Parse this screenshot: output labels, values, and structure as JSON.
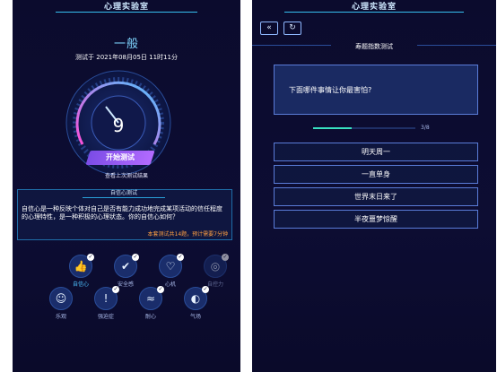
{
  "left": {
    "header_title": "心理实验室",
    "level": "一般",
    "test_time": "测试于 2021年08月05日 11时11分",
    "score": "9",
    "start_button": "开始测试",
    "last_result_link": "查看上次测试结果",
    "description": {
      "tab": "自信心测试",
      "text": "自信心是一种反映个体对自己是否有能力成功地完成某项活动的信任程度的心理特性，是一种积极的心理状态。你的自信心如何？",
      "footer": "本套测试共14题，预计需要7分钟"
    },
    "categories": [
      {
        "label": "自信心",
        "icon": "thumbs-up-icon",
        "glyph": "👍",
        "checked": true,
        "selected": true
      },
      {
        "label": "安全感",
        "icon": "shield-check-icon",
        "glyph": "✔",
        "checked": true,
        "selected": false
      },
      {
        "label": "心机",
        "icon": "heart-icon",
        "glyph": "♡",
        "checked": true,
        "selected": false
      },
      {
        "label": "自控力",
        "icon": "control-icon",
        "glyph": "◎",
        "checked": true,
        "selected": false
      },
      {
        "label": "乐观",
        "icon": "smile-icon",
        "glyph": "☺",
        "checked": false,
        "selected": false
      },
      {
        "label": "强迫症",
        "icon": "exclamation-icon",
        "glyph": "!",
        "checked": true,
        "selected": false
      },
      {
        "label": "耐心",
        "icon": "patience-icon",
        "glyph": "≈",
        "checked": true,
        "selected": false
      },
      {
        "label": "气场",
        "icon": "aura-icon",
        "glyph": "◐",
        "checked": true,
        "selected": false
      }
    ]
  },
  "right": {
    "header_title": "心理实验室",
    "nav_back_glyph": "«",
    "nav_refresh_glyph": "↻",
    "section_title": "寿题指数测试",
    "question": "下面哪件事情让你最害怕?",
    "progress_text": "3/8",
    "progress_fraction": 0.375,
    "options": [
      "明天周一",
      "一直单身",
      "世界末日来了",
      "半夜噩梦惊醒"
    ]
  },
  "colors": {
    "accent": "#4ec3ff",
    "button": "#9b5cf5",
    "orange": "#ffa042",
    "progress": "#38e0c0"
  }
}
